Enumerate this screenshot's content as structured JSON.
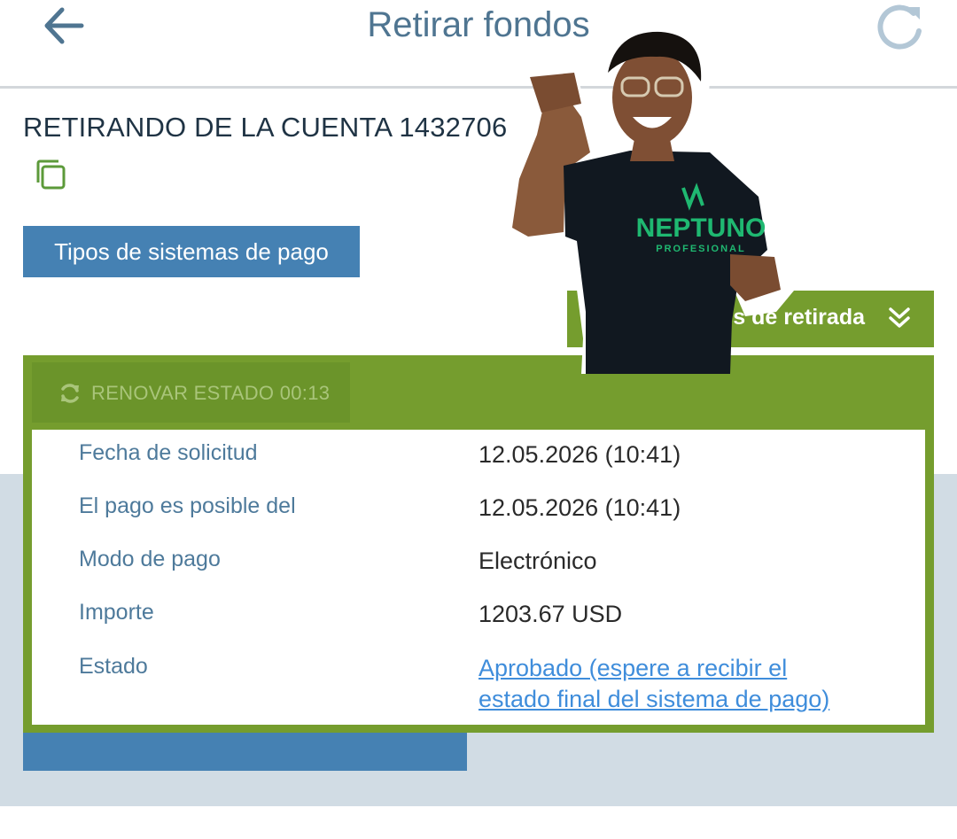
{
  "header": {
    "title": "Retirar fondos",
    "back_icon": "arrow-left-icon",
    "refresh_icon": "refresh-icon"
  },
  "account": {
    "label": "RETIRANDO DE LA CUENTA 1432706",
    "suffix_visible": "5",
    "copy_icon": "copy-icon"
  },
  "payment_types_button": "Tipos de sistemas de pago",
  "details_button": {
    "label": "es de retirada",
    "icon": "chevron-double-down-icon"
  },
  "status_panel": {
    "renew_label": "RENOVAR ESTADO 00:13",
    "renew_icon": "sync-icon",
    "rows": [
      {
        "label": "Fecha de solicitud",
        "value": "12.05.2026 (10:41)"
      },
      {
        "label": "El pago es posible del",
        "value": "12.05.2026 (10:41)"
      },
      {
        "label": "Modo de pago",
        "value": "Electrónico"
      },
      {
        "label": "Importe",
        "value": "1203.67 USD"
      },
      {
        "label": "Estado",
        "value_line1": "Aprobado (espere a recibir el",
        "value_line2": "estado final del sistema de pago)"
      }
    ]
  },
  "overlay": {
    "shirt_text": "NEPTUNO",
    "shirt_subtext": "PROFESIONAL"
  },
  "colors": {
    "accent_blue": "#4581b3",
    "panel_green": "#759d2e",
    "title_blue": "#4f7591",
    "link_blue": "#3f8ddb"
  }
}
